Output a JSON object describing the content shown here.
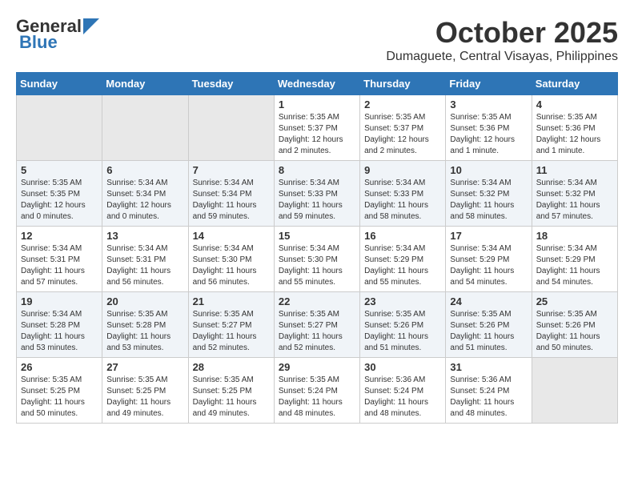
{
  "header": {
    "logo_line1": "General",
    "logo_line2": "Blue",
    "title": "October 2025",
    "subtitle": "Dumaguete, Central Visayas, Philippines"
  },
  "days_of_week": [
    "Sunday",
    "Monday",
    "Tuesday",
    "Wednesday",
    "Thursday",
    "Friday",
    "Saturday"
  ],
  "weeks": [
    [
      {
        "day": "",
        "info": ""
      },
      {
        "day": "",
        "info": ""
      },
      {
        "day": "",
        "info": ""
      },
      {
        "day": "1",
        "info": "Sunrise: 5:35 AM\nSunset: 5:37 PM\nDaylight: 12 hours\nand 2 minutes."
      },
      {
        "day": "2",
        "info": "Sunrise: 5:35 AM\nSunset: 5:37 PM\nDaylight: 12 hours\nand 2 minutes."
      },
      {
        "day": "3",
        "info": "Sunrise: 5:35 AM\nSunset: 5:36 PM\nDaylight: 12 hours\nand 1 minute."
      },
      {
        "day": "4",
        "info": "Sunrise: 5:35 AM\nSunset: 5:36 PM\nDaylight: 12 hours\nand 1 minute."
      }
    ],
    [
      {
        "day": "5",
        "info": "Sunrise: 5:35 AM\nSunset: 5:35 PM\nDaylight: 12 hours\nand 0 minutes."
      },
      {
        "day": "6",
        "info": "Sunrise: 5:34 AM\nSunset: 5:34 PM\nDaylight: 12 hours\nand 0 minutes."
      },
      {
        "day": "7",
        "info": "Sunrise: 5:34 AM\nSunset: 5:34 PM\nDaylight: 11 hours\nand 59 minutes."
      },
      {
        "day": "8",
        "info": "Sunrise: 5:34 AM\nSunset: 5:33 PM\nDaylight: 11 hours\nand 59 minutes."
      },
      {
        "day": "9",
        "info": "Sunrise: 5:34 AM\nSunset: 5:33 PM\nDaylight: 11 hours\nand 58 minutes."
      },
      {
        "day": "10",
        "info": "Sunrise: 5:34 AM\nSunset: 5:32 PM\nDaylight: 11 hours\nand 58 minutes."
      },
      {
        "day": "11",
        "info": "Sunrise: 5:34 AM\nSunset: 5:32 PM\nDaylight: 11 hours\nand 57 minutes."
      }
    ],
    [
      {
        "day": "12",
        "info": "Sunrise: 5:34 AM\nSunset: 5:31 PM\nDaylight: 11 hours\nand 57 minutes."
      },
      {
        "day": "13",
        "info": "Sunrise: 5:34 AM\nSunset: 5:31 PM\nDaylight: 11 hours\nand 56 minutes."
      },
      {
        "day": "14",
        "info": "Sunrise: 5:34 AM\nSunset: 5:30 PM\nDaylight: 11 hours\nand 56 minutes."
      },
      {
        "day": "15",
        "info": "Sunrise: 5:34 AM\nSunset: 5:30 PM\nDaylight: 11 hours\nand 55 minutes."
      },
      {
        "day": "16",
        "info": "Sunrise: 5:34 AM\nSunset: 5:29 PM\nDaylight: 11 hours\nand 55 minutes."
      },
      {
        "day": "17",
        "info": "Sunrise: 5:34 AM\nSunset: 5:29 PM\nDaylight: 11 hours\nand 54 minutes."
      },
      {
        "day": "18",
        "info": "Sunrise: 5:34 AM\nSunset: 5:29 PM\nDaylight: 11 hours\nand 54 minutes."
      }
    ],
    [
      {
        "day": "19",
        "info": "Sunrise: 5:34 AM\nSunset: 5:28 PM\nDaylight: 11 hours\nand 53 minutes."
      },
      {
        "day": "20",
        "info": "Sunrise: 5:35 AM\nSunset: 5:28 PM\nDaylight: 11 hours\nand 53 minutes."
      },
      {
        "day": "21",
        "info": "Sunrise: 5:35 AM\nSunset: 5:27 PM\nDaylight: 11 hours\nand 52 minutes."
      },
      {
        "day": "22",
        "info": "Sunrise: 5:35 AM\nSunset: 5:27 PM\nDaylight: 11 hours\nand 52 minutes."
      },
      {
        "day": "23",
        "info": "Sunrise: 5:35 AM\nSunset: 5:26 PM\nDaylight: 11 hours\nand 51 minutes."
      },
      {
        "day": "24",
        "info": "Sunrise: 5:35 AM\nSunset: 5:26 PM\nDaylight: 11 hours\nand 51 minutes."
      },
      {
        "day": "25",
        "info": "Sunrise: 5:35 AM\nSunset: 5:26 PM\nDaylight: 11 hours\nand 50 minutes."
      }
    ],
    [
      {
        "day": "26",
        "info": "Sunrise: 5:35 AM\nSunset: 5:25 PM\nDaylight: 11 hours\nand 50 minutes."
      },
      {
        "day": "27",
        "info": "Sunrise: 5:35 AM\nSunset: 5:25 PM\nDaylight: 11 hours\nand 49 minutes."
      },
      {
        "day": "28",
        "info": "Sunrise: 5:35 AM\nSunset: 5:25 PM\nDaylight: 11 hours\nand 49 minutes."
      },
      {
        "day": "29",
        "info": "Sunrise: 5:35 AM\nSunset: 5:24 PM\nDaylight: 11 hours\nand 48 minutes."
      },
      {
        "day": "30",
        "info": "Sunrise: 5:36 AM\nSunset: 5:24 PM\nDaylight: 11 hours\nand 48 minutes."
      },
      {
        "day": "31",
        "info": "Sunrise: 5:36 AM\nSunset: 5:24 PM\nDaylight: 11 hours\nand 48 minutes."
      },
      {
        "day": "",
        "info": ""
      }
    ]
  ]
}
